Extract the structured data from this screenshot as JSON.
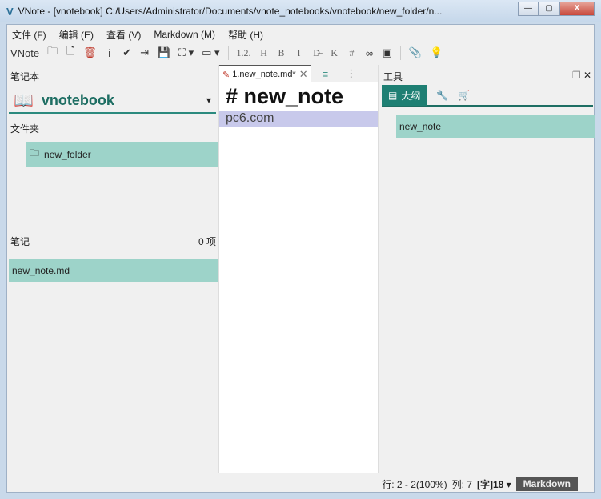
{
  "window": {
    "logo": "V",
    "title": "VNote - [vnotebook] C:/Users/Administrator/Documents/vnote_notebooks/vnotebook/new_folder/n...",
    "minimize": "—",
    "maximize": "▢",
    "close": "X"
  },
  "menu": [
    "文件 (F)",
    "编辑 (E)",
    "查看 (V)",
    "Markdown (M)",
    "帮助 (H)"
  ],
  "toolbar": {
    "label": "VNote",
    "items": [
      {
        "name": "folder-icon",
        "glyph": "🗀"
      },
      {
        "name": "new-note-icon",
        "glyph": "🗋"
      },
      {
        "name": "delete-icon",
        "glyph": "🗑"
      },
      {
        "name": "info-icon",
        "glyph": "i"
      },
      {
        "name": "check-icon",
        "glyph": "✔"
      },
      {
        "name": "import-icon",
        "glyph": "⇥"
      },
      {
        "name": "save-icon",
        "glyph": "💾"
      },
      {
        "name": "expand-icon",
        "glyph": "⛶ ▾"
      },
      {
        "name": "display-icon",
        "glyph": "▭ ▾"
      },
      {
        "name": "numbered-list-icon",
        "glyph": "1.2."
      },
      {
        "name": "heading-icon",
        "glyph": "H"
      },
      {
        "name": "bold-icon",
        "glyph": "B"
      },
      {
        "name": "italic-icon",
        "glyph": "I"
      },
      {
        "name": "strikethrough-icon",
        "glyph": "D̶"
      },
      {
        "name": "code-icon",
        "glyph": "K"
      },
      {
        "name": "hash-icon",
        "glyph": "#"
      },
      {
        "name": "link-icon",
        "glyph": "∞"
      },
      {
        "name": "image-icon",
        "glyph": "▣"
      },
      {
        "name": "attachment-icon",
        "glyph": "📎"
      },
      {
        "name": "bulb-icon",
        "glyph": "💡"
      }
    ]
  },
  "left": {
    "notebook_header": "笔记本",
    "notebook": "vnotebook",
    "folders_header": "文件夹",
    "folder": "new_folder",
    "notes_header": "笔记",
    "notes_count": "0 项",
    "note": "new_note.md"
  },
  "editor": {
    "tab": "1.new_note.md*",
    "heading": "# new_note",
    "line2": "pc6.com"
  },
  "tools": {
    "header": "工具",
    "tab_outline": "大纲",
    "outline_item": "new_note"
  },
  "status": {
    "line": "行: 2 - 2(100%)",
    "col": "列: 7",
    "font": "[字]18 ▾",
    "mode": "Markdown"
  }
}
